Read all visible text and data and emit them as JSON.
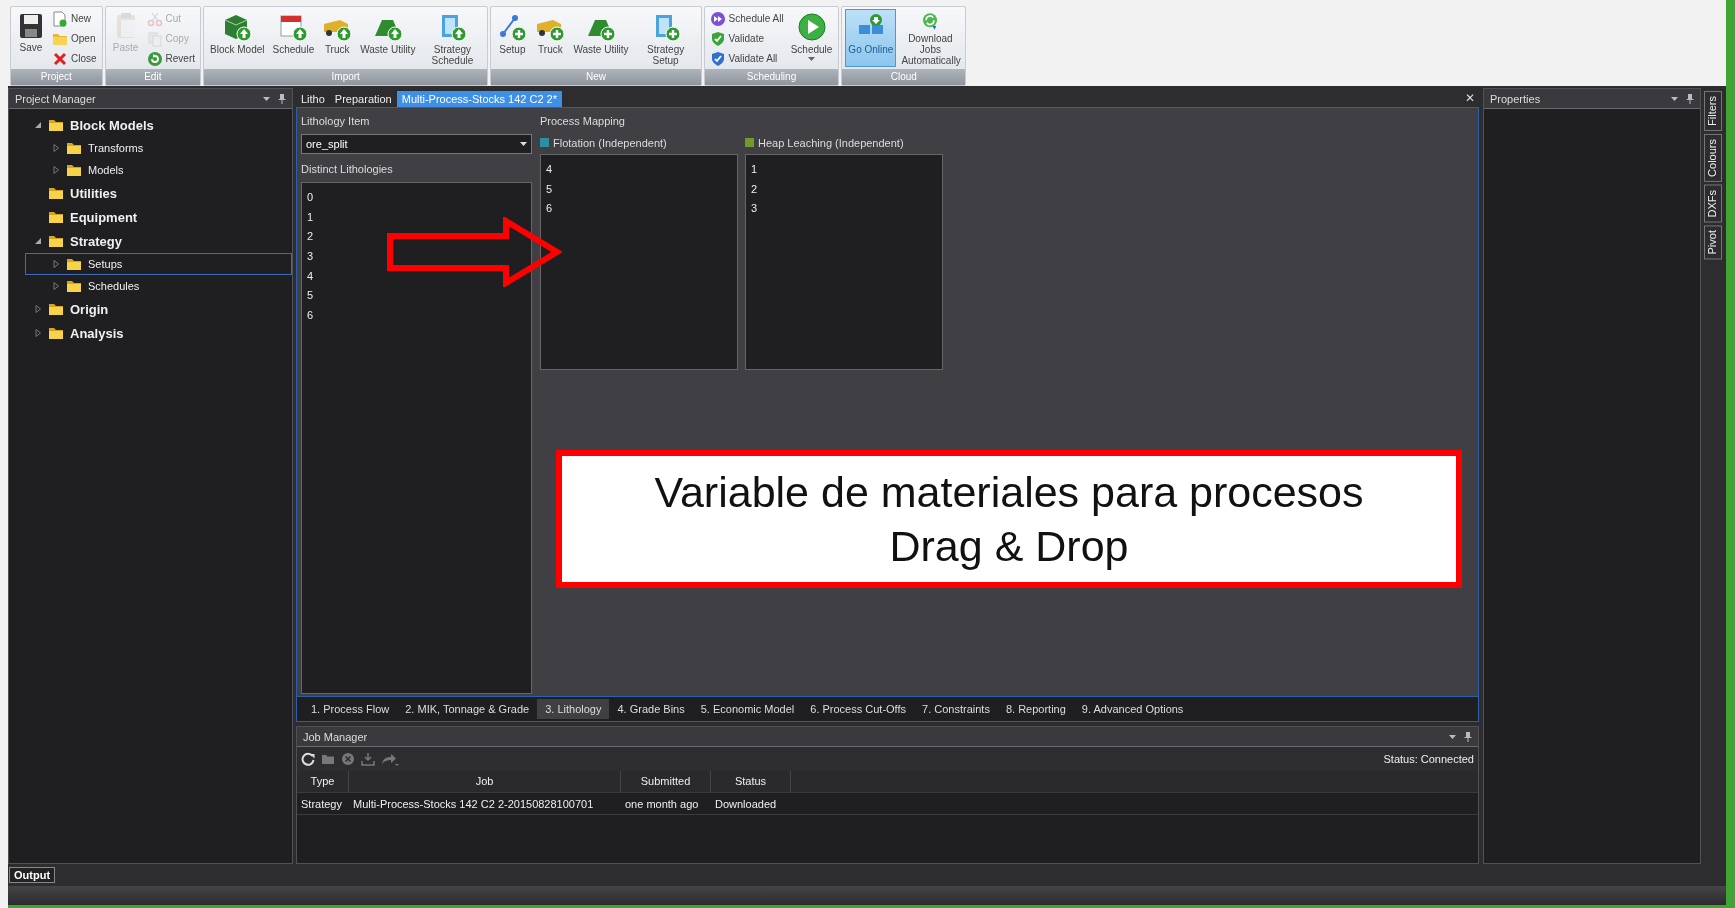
{
  "ribbon": {
    "groups": [
      {
        "label": "Project",
        "items": [
          {
            "label": "Save",
            "kind": "large",
            "disabled": false,
            "on": false
          },
          {
            "label": "New",
            "kind": "small",
            "disabled": false,
            "on": false
          },
          {
            "label": "Open",
            "kind": "small",
            "disabled": false,
            "on": false
          },
          {
            "label": "Close",
            "kind": "small",
            "disabled": false,
            "on": false
          }
        ]
      },
      {
        "label": "Edit",
        "items": [
          {
            "label": "Paste",
            "kind": "large",
            "disabled": true,
            "on": false
          },
          {
            "label": "Cut",
            "kind": "small",
            "disabled": true,
            "on": false
          },
          {
            "label": "Copy",
            "kind": "small",
            "disabled": true,
            "on": false
          },
          {
            "label": "Revert",
            "kind": "small",
            "disabled": false,
            "on": false
          }
        ]
      },
      {
        "label": "Import",
        "items": [
          {
            "label": "Block Model",
            "kind": "large",
            "disabled": false,
            "on": false
          },
          {
            "label": "Schedule",
            "kind": "large",
            "disabled": false,
            "on": false
          },
          {
            "label": "Truck",
            "kind": "large",
            "disabled": false,
            "on": false
          },
          {
            "label": "Waste Utility",
            "kind": "large",
            "disabled": false,
            "on": false
          },
          {
            "label": "Strategy Schedule",
            "kind": "large",
            "disabled": false,
            "on": false
          }
        ]
      },
      {
        "label": "New",
        "items": [
          {
            "label": "Setup",
            "kind": "large",
            "disabled": false,
            "on": false
          },
          {
            "label": "Truck",
            "kind": "large",
            "disabled": false,
            "on": false
          },
          {
            "label": "Waste Utility",
            "kind": "large",
            "disabled": false,
            "on": false
          },
          {
            "label": "Strategy Setup",
            "kind": "large",
            "disabled": false,
            "on": false
          }
        ]
      },
      {
        "label": "Scheduling",
        "items": [
          {
            "label": "Schedule All",
            "kind": "small",
            "disabled": false,
            "on": false
          },
          {
            "label": "Validate",
            "kind": "small",
            "disabled": false,
            "on": false
          },
          {
            "label": "Validate All",
            "kind": "small",
            "disabled": false,
            "on": false
          },
          {
            "label": "Schedule",
            "kind": "dropdown",
            "disabled": false,
            "on": false
          }
        ]
      },
      {
        "label": "Cloud",
        "items": [
          {
            "label": "Go Online",
            "kind": "large",
            "disabled": false,
            "on": true
          },
          {
            "label": "Download Jobs Automatically",
            "kind": "large",
            "disabled": false,
            "on": false
          }
        ]
      }
    ]
  },
  "project_manager": {
    "title": "Project Manager",
    "tree": [
      {
        "label": "Block Models",
        "expandable": true,
        "expanded": true,
        "selected": false,
        "children": [
          {
            "label": "Transforms",
            "expandable": true,
            "expanded": false,
            "selected": false
          },
          {
            "label": "Models",
            "expandable": true,
            "expanded": false,
            "selected": false
          }
        ]
      },
      {
        "label": "Utilities",
        "expandable": false,
        "selected": false
      },
      {
        "label": "Equipment",
        "expandable": false,
        "selected": false
      },
      {
        "label": "Strategy",
        "expandable": true,
        "expanded": true,
        "selected": false,
        "children": [
          {
            "label": "Setups",
            "expandable": true,
            "expanded": false,
            "selected": true
          },
          {
            "label": "Schedules",
            "expandable": true,
            "expanded": false,
            "selected": false
          }
        ]
      },
      {
        "label": "Origin",
        "expandable": true,
        "expanded": false,
        "selected": false
      },
      {
        "label": "Analysis",
        "expandable": true,
        "expanded": false,
        "selected": false
      }
    ]
  },
  "document": {
    "tabs": [
      {
        "label": "Litho",
        "selected": false
      },
      {
        "label": "Preparation",
        "selected": false
      },
      {
        "label": "Multi-Process-Stocks 142 C2 2*",
        "selected": true
      }
    ],
    "close": "✕",
    "lithology_item": {
      "label": "Lithology Item",
      "value": "ore_split"
    },
    "distinct_lithologies": {
      "label": "Distinct Lithologies",
      "items": [
        "0",
        "1",
        "2",
        "3",
        "4",
        "5",
        "6"
      ]
    },
    "process_mapping": {
      "label": "Process Mapping",
      "processes": [
        {
          "name": "Flotation (Independent)",
          "color": "#2e8fa3",
          "items": [
            "4",
            "5",
            "6"
          ]
        },
        {
          "name": "Heap Leaching (Independent)",
          "color": "#6f9a2e",
          "items": [
            "1",
            "2",
            "3"
          ]
        }
      ]
    },
    "bottom_tabs": [
      {
        "label": "1. Process Flow",
        "selected": false
      },
      {
        "label": "2. MIK, Tonnage & Grade",
        "selected": false
      },
      {
        "label": "3. Lithology",
        "selected": true
      },
      {
        "label": "4. Grade Bins",
        "selected": false
      },
      {
        "label": "5. Economic Model",
        "selected": false
      },
      {
        "label": "6. Process Cut-Offs",
        "selected": false
      },
      {
        "label": "7. Constraints",
        "selected": false
      },
      {
        "label": "8. Reporting",
        "selected": false
      },
      {
        "label": "9. Advanced Options",
        "selected": false
      }
    ]
  },
  "job_manager": {
    "title": "Job Manager",
    "status": "Status: Connected",
    "columns": [
      "Type",
      "Job",
      "Submitted",
      "Status"
    ],
    "rows": [
      [
        "Strategy",
        "Multi-Process-Stocks 142 C2 2-20150828100701",
        "one month ago",
        "Downloaded"
      ]
    ]
  },
  "properties": {
    "title": "Properties"
  },
  "side_tabs": [
    "Filters",
    "Colours",
    "DXFs",
    "Pivot"
  ],
  "output_tab": "Output",
  "annotations": [
    {
      "kind": "arrow"
    },
    {
      "kind": "callout",
      "lines": [
        "Variable de materiales para procesos",
        "Drag & Drop"
      ]
    }
  ]
}
